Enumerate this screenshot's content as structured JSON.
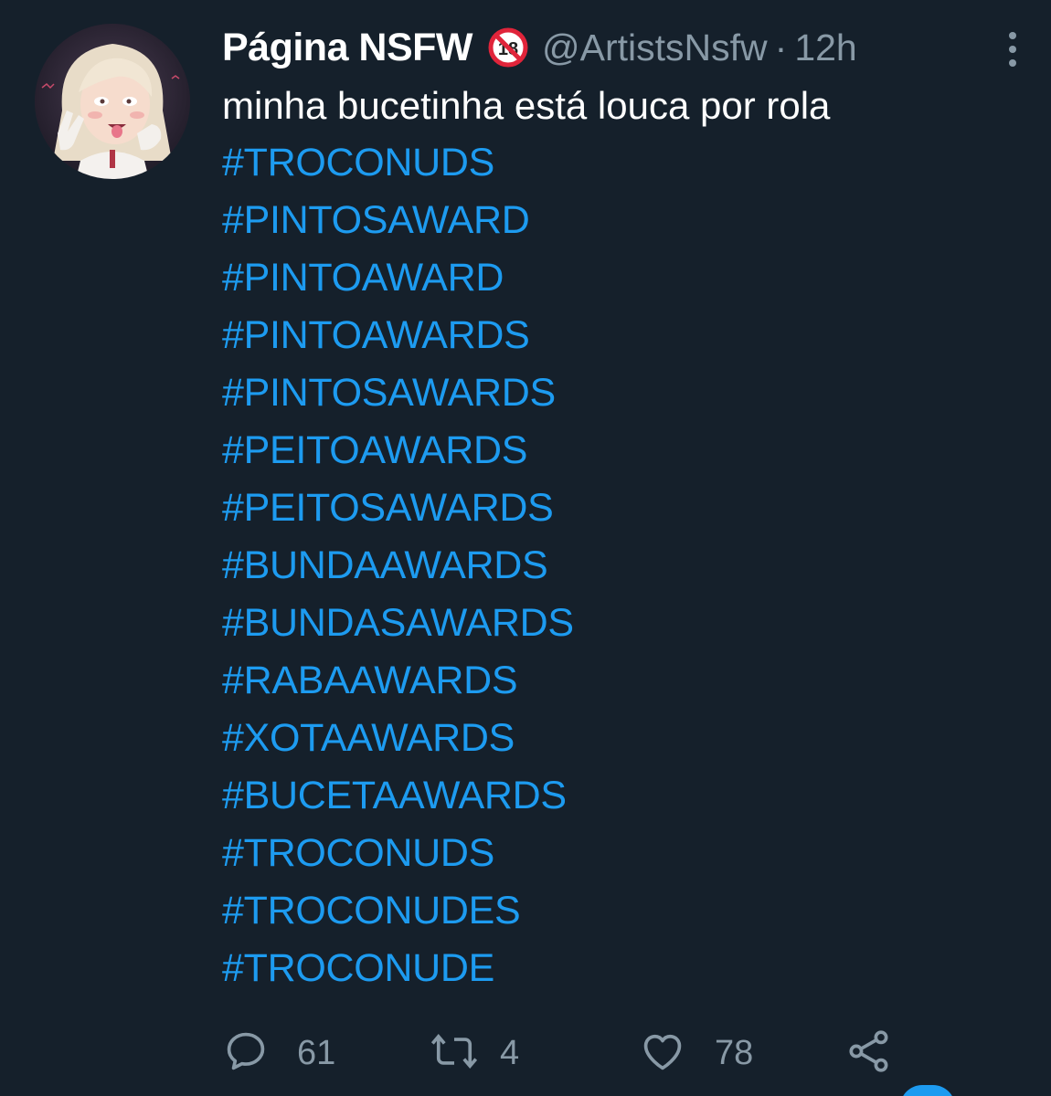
{
  "tweet": {
    "display_name": "Página NSFW",
    "badge_icon": "no-under-18-icon",
    "handle": "@ArtistsNsfw",
    "separator": "·",
    "time": "12h",
    "text": "minha bucetinha está louca por rola",
    "hashtags": [
      "#TROCONUDS",
      "#PINTOSAWARD",
      "#PINTOAWARD",
      "#PINTOAWARDS",
      "#PINTOSAWARDS",
      "#PEITOAWARDS",
      "#PEITOSAWARDS",
      "#BUNDAAWARDS",
      "#BUNDASAWARDS",
      "#RABAAWARDS",
      "#XOTAAWARDS",
      "#BUCETAAWARDS",
      "#TROCONUDS",
      "#TROCONUDES",
      "#TROCONUDE"
    ]
  },
  "actions": {
    "reply": {
      "icon": "reply-icon",
      "count": "61"
    },
    "retweet": {
      "icon": "retweet-icon",
      "count": "4"
    },
    "like": {
      "icon": "heart-icon",
      "count": "78"
    },
    "share": {
      "icon": "share-icon"
    }
  },
  "colors": {
    "background": "#15202b",
    "text": "#ffffff",
    "secondary": "#8899a6",
    "link": "#1d9bf0"
  }
}
